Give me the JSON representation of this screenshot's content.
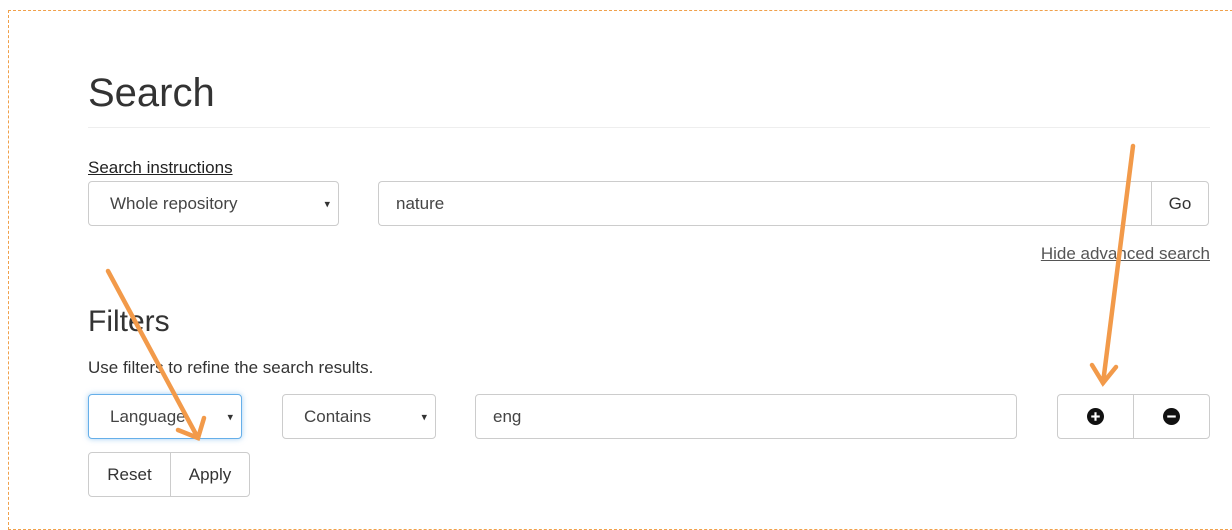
{
  "search": {
    "title": "Search",
    "instructions_link": "Search instructions",
    "scope_selected": "Whole repository",
    "query_value": "nature",
    "go_label": "Go",
    "hide_advanced_link": "Hide advanced search"
  },
  "filters": {
    "title": "Filters",
    "help_text": "Use filters to refine the search results.",
    "field_selected": "Language",
    "operator_selected": "Contains",
    "value": "eng",
    "add_icon": "plus-circle-icon",
    "remove_icon": "minus-circle-icon",
    "reset_label": "Reset",
    "apply_label": "Apply"
  },
  "icons": {
    "caret": "▾"
  },
  "colors": {
    "annotation_arrow": "#f29a4a",
    "focus_border": "#66afe9",
    "frame_border": "#f0a04a"
  }
}
